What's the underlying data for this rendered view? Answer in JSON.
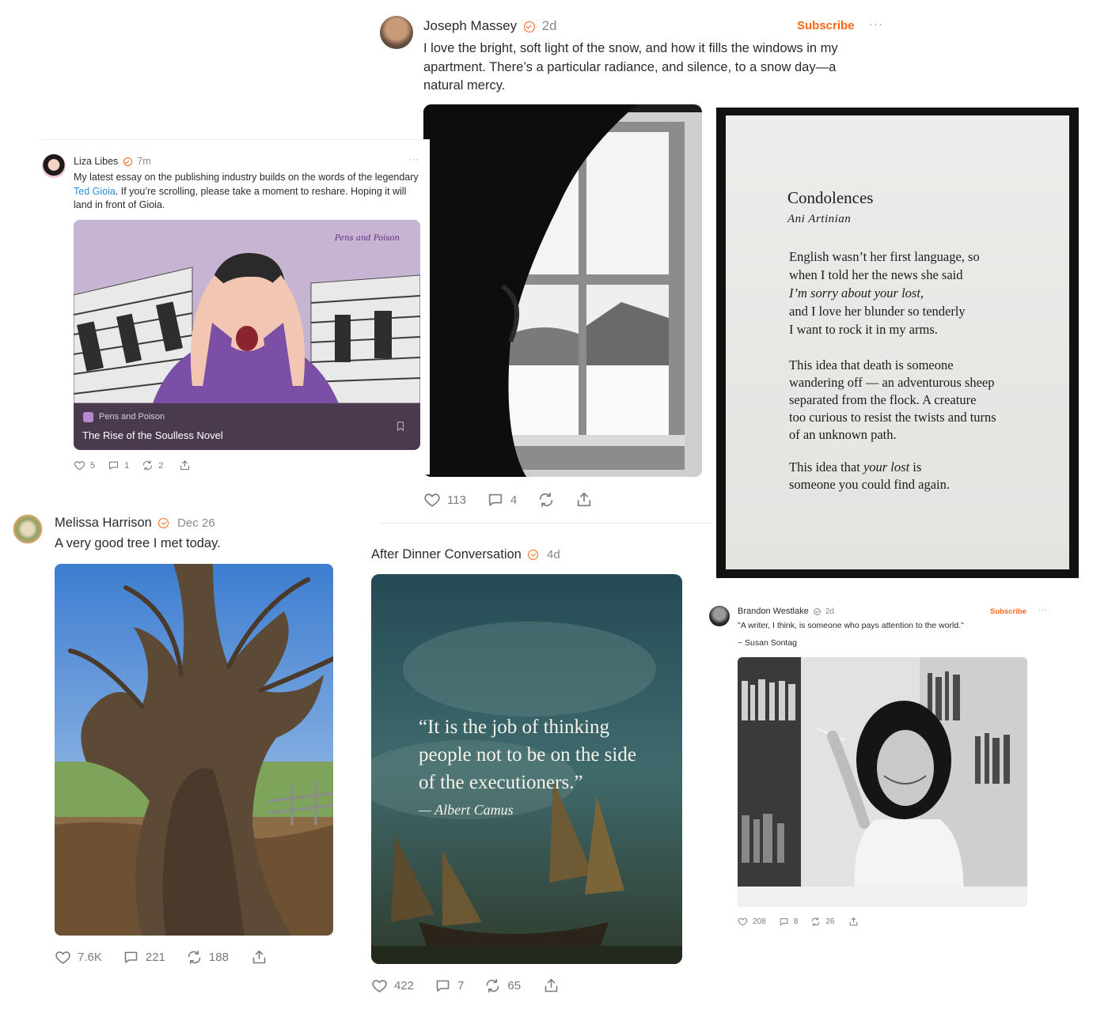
{
  "post_massey": {
    "author": "Joseph Massey",
    "time": "2d",
    "subscribe_label": "Subscribe",
    "more_label": "···",
    "text": "I love the bright, soft light of the snow, and how it fills the windows in my apartment. There’s a particular radiance, and silence, to a snow day—a natural mercy.",
    "likes": "113",
    "comments": "4"
  },
  "post_libes": {
    "author": "Liza Libes",
    "time": "7m",
    "more_label": "···",
    "text_before_link": "My latest essay on the publishing industry builds on the words of the legendary ",
    "link_text": "Ted Gioia",
    "text_after_link": ". If you’re scrolling, please take a moment to reshare. Hoping it will land in front of Gioia.",
    "card_watermark": "Pens and Poison",
    "card_publication": "Pens and Poison",
    "card_title": "The Rise of the Soulless Novel",
    "likes": "5",
    "comments": "1",
    "restacks": "2"
  },
  "poem": {
    "title": "Condolences",
    "author": "Ani Artinian",
    "stanza1": [
      "English wasn’t her first language, so",
      "when I told her the news she said",
      "I’m sorry about your lost,",
      "and I love her blunder so tenderly",
      "I want to rock it in my arms."
    ],
    "stanza2": [
      "This idea that death is someone",
      "wandering off — an adventurous sheep",
      "separated from the flock. A creature",
      "too curious to resist the twists and turns",
      "of an unknown path."
    ],
    "stanza3_line1_a": "This idea that ",
    "stanza3_line1_b": "your lost",
    "stanza3_line1_c": " is",
    "stanza3_line2": "someone you could find again."
  },
  "post_harrison": {
    "author": "Melissa Harrison",
    "time": "Dec 26",
    "text": "A very good tree I met today.",
    "likes": "7.6K",
    "comments": "221",
    "restacks": "188"
  },
  "post_adc": {
    "author": "After Dinner Conversation",
    "time": "4d",
    "quote": "“It is the job of thinking people not to be on the side of the executioners.”",
    "quote_author": "— Albert Camus",
    "likes": "422",
    "comments": "7",
    "restacks": "65"
  },
  "post_westlake": {
    "author": "Brandon Westlake",
    "time": "2d",
    "subscribe_label": "Subscribe",
    "more_label": "···",
    "text_line1": "\"A writer, I think, is someone who pays attention to the world.\"",
    "text_line2": "~ Susan Sontag",
    "likes": "208",
    "comments": "8",
    "restacks": "26"
  }
}
